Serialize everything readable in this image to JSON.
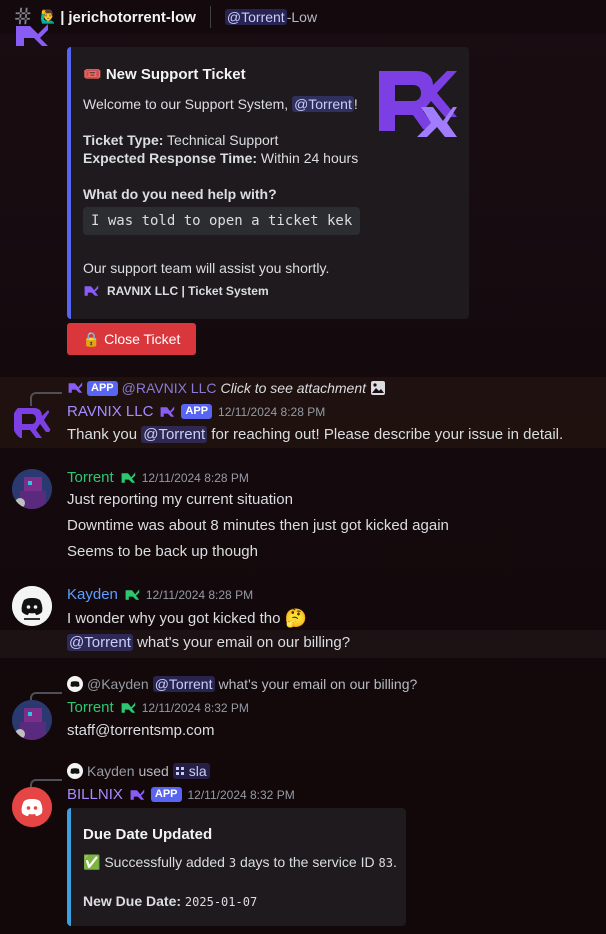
{
  "header": {
    "channel_emoji": "🙋‍♂",
    "channel_name": "jerichotorrent-low",
    "topic_mention": "@Torrent",
    "topic_suffix": "-Low"
  },
  "ticket_embed": {
    "title": "🎟️ New Support Ticket",
    "welcome_prefix": "Welcome to our Support System, ",
    "welcome_mention": "@Torrent",
    "welcome_suffix": "!",
    "type_label": "Ticket Type:",
    "type_value": " Technical Support",
    "response_label": "Expected Response Time:",
    "response_value": " Within 24 hours",
    "question": "What do you need help with?",
    "answer": "I was told to open a ticket kek",
    "assist_text": "Our support team will assist you shortly.",
    "footer": "RAVNIX LLC | Ticket System"
  },
  "close_button": {
    "icon": "🔒",
    "label": "Close Ticket"
  },
  "ravnix_reply": {
    "tag": "APP",
    "mention": "@RAVNIX LLC",
    "text": "Click to see attachment"
  },
  "ravnix_msg": {
    "username": "RAVNIX LLC",
    "tag": "APP",
    "timestamp": "12/11/2024 8:28 PM",
    "prefix": "Thank you ",
    "mention": "@Torrent",
    "suffix": " for reaching out! Please describe your issue in detail."
  },
  "torrent_msg1": {
    "username": "Torrent",
    "timestamp": "12/11/2024 8:28 PM",
    "lines": [
      "Just reporting my current situation",
      "Downtime was about 8 minutes then just got kicked again",
      "Seems to be back up though"
    ]
  },
  "kayden_msg": {
    "username": "Kayden",
    "timestamp": "12/11/2024 8:28 PM",
    "line1": "I wonder why you got kicked tho",
    "line1_emoji": "🤔",
    "line2_mention": "@Torrent",
    "line2_text": " what's your email on our billing?"
  },
  "torrent_reply": {
    "author": "@Kayden",
    "mention": "@Torrent",
    "text": "what's your email on our billing?"
  },
  "torrent_msg2": {
    "username": "Torrent",
    "timestamp": "12/11/2024 8:32 PM",
    "text": "staff@torrentsmp.com"
  },
  "billnix_reply": {
    "author": "Kayden",
    "used": "used",
    "command": "sla"
  },
  "billnix_msg": {
    "username": "BILLNIX",
    "tag": "APP",
    "timestamp": "12/11/2024 8:32 PM"
  },
  "due_embed": {
    "title": "Due Date Updated",
    "check": "✅",
    "text_prefix": "Successfully added ",
    "days": "3",
    "text_mid": " days to the service ID ",
    "service_id": "83",
    "text_suffix": ".",
    "due_label": "New Due Date:",
    "due_value": "2025-01-07"
  },
  "colors": {
    "accent": "#5865f2",
    "torrent_name": "#2dc770",
    "kayden_name": "#5e9eff",
    "ravnix_name": "#a58cff",
    "danger": "#da373c"
  }
}
